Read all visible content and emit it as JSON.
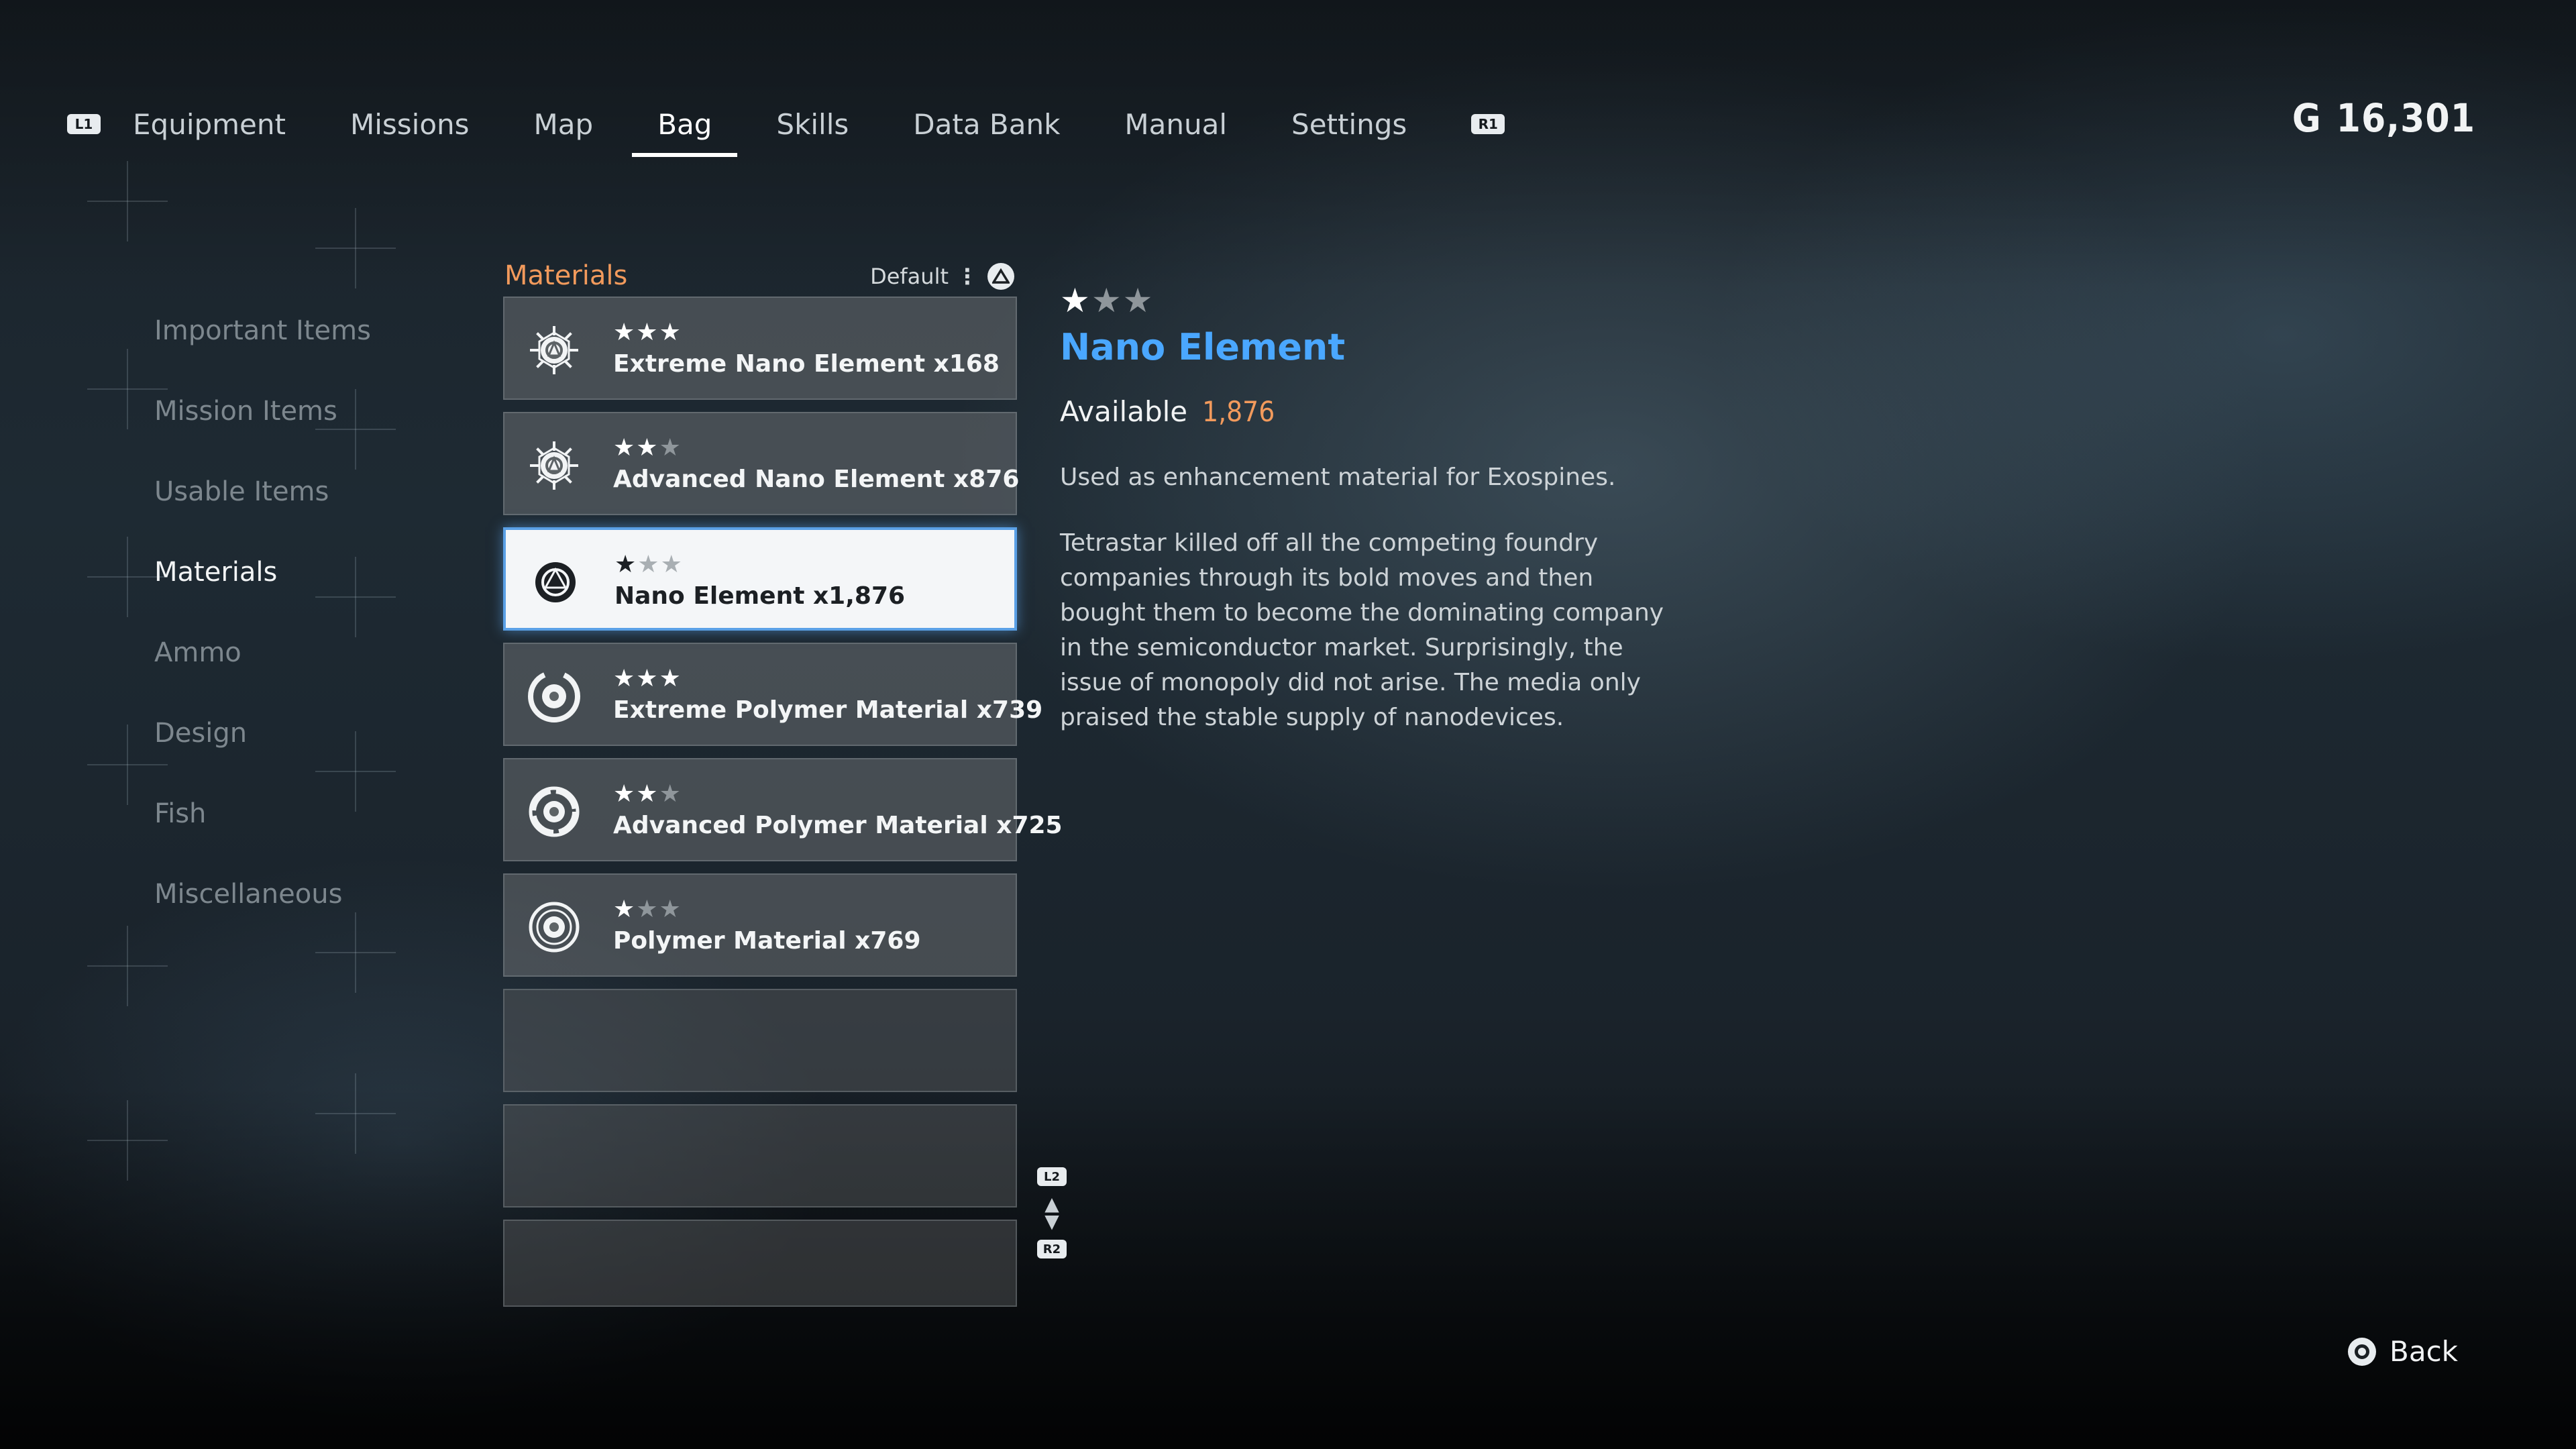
{
  "nav": {
    "left_hint": "L1",
    "right_hint": "R1",
    "tabs": [
      "Equipment",
      "Missions",
      "Map",
      "Bag",
      "Skills",
      "Data Bank",
      "Manual",
      "Settings"
    ],
    "active_tab": "Bag"
  },
  "currency": {
    "symbol": "G",
    "amount": "16,301"
  },
  "sidebar": {
    "items": [
      "Important Items",
      "Mission Items",
      "Usable Items",
      "Materials",
      "Ammo",
      "Design",
      "Fish",
      "Miscellaneous"
    ],
    "active": "Materials"
  },
  "list": {
    "title": "Materials",
    "sort_label": "Default",
    "items": [
      {
        "name": "Extreme Nano Element x168",
        "stars": 3,
        "icon": "nano-extreme-icon"
      },
      {
        "name": "Advanced Nano Element x876",
        "stars": 2,
        "icon": "nano-advanced-icon"
      },
      {
        "name": "Nano Element x1,876",
        "stars": 1,
        "icon": "nano-icon",
        "selected": true
      },
      {
        "name": "Extreme Polymer Material x739",
        "stars": 3,
        "icon": "polymer-extreme-icon"
      },
      {
        "name": "Advanced Polymer Material x725",
        "stars": 2,
        "icon": "polymer-advanced-icon"
      },
      {
        "name": "Polymer Material x769",
        "stars": 1,
        "icon": "polymer-icon"
      }
    ],
    "empty_slots": 3,
    "scroll_up_hint": "L2",
    "scroll_down_hint": "R2"
  },
  "detail": {
    "stars": 1,
    "max_stars": 3,
    "title": "Nano Element",
    "available_label": "Available",
    "available_value": "1,876",
    "description": "Used as enhancement material for Exospines.",
    "lore": "Tetrastar killed off all the competing foundry companies through its bold moves and then bought them to become the dominating company in the semiconductor market. Surprisingly, the issue of monopoly did not arise. The media only praised the stable supply of nanodevices."
  },
  "footer": {
    "back_label": "Back"
  },
  "colors": {
    "accent_orange": "#f29a5c",
    "accent_blue": "#4aa7ff",
    "selection_border": "#5aa0e6"
  }
}
